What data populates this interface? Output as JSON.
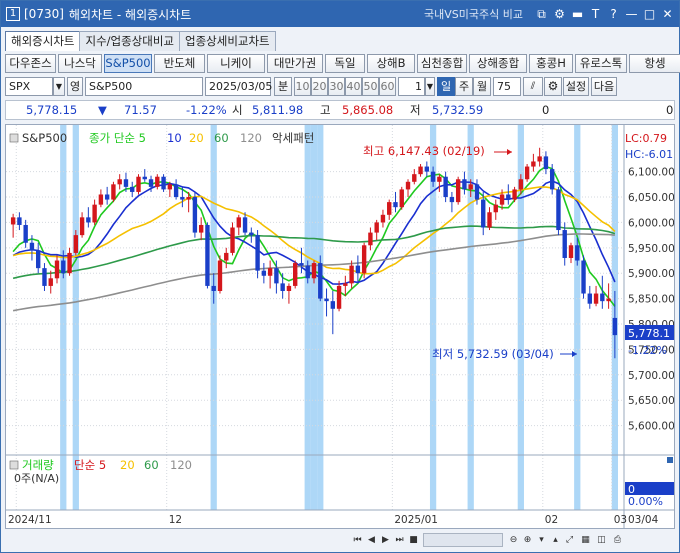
{
  "window": {
    "code": "[0730]",
    "title": "해외차트 - 해외증시차트",
    "compare_link": "국내VS미국주식 비교",
    "controls": [
      "⧉",
      "⚙",
      "▬",
      "T",
      "?",
      "—",
      "□",
      "✕"
    ]
  },
  "tabs": [
    "해외증시차트",
    "지수/업종상대비교",
    "업종상세비교차트"
  ],
  "index_buttons": [
    "다우존스",
    "나스닥",
    "S&P500",
    "반도체",
    "니케이",
    "대만가권",
    "독일",
    "상해B",
    "심천종합",
    "상해종합",
    "홍콩H",
    "유로스톡",
    "항셍"
  ],
  "toolbar": {
    "symbol": "SPX",
    "type_label": "영",
    "name": "S&P500",
    "date": "2025/03/05",
    "unit_label": "분",
    "periods": [
      "10",
      "20",
      "30",
      "40",
      "50",
      "60"
    ],
    "count": "1",
    "day": "일",
    "week": "주",
    "month": "월",
    "bars": "75",
    "settings": "설정",
    "next": "다음"
  },
  "price": {
    "last": "5,778.15",
    "arrow": "▼",
    "change": "71.57",
    "pct": "-1.22%",
    "open_label": "시",
    "open": "5,811.98",
    "high_label": "고",
    "high": "5,865.08",
    "low_label": "저",
    "low": "5,732.59",
    "vol1": "0",
    "vol2": "0"
  },
  "legend": {
    "name": "S&P500",
    "ma_label": "종가 단순 5",
    "ma10": "10",
    "ma20": "20",
    "ma60": "60",
    "ma120": "120",
    "pattern": "악세패턴",
    "lc": "LC:0.79",
    "hc": "HC:-6.01"
  },
  "annotations": {
    "high": "최고 6,147.43 (02/19)",
    "low": "최저 5,732.59 (03/04)",
    "last_tag": "5,778.1",
    "pct_tag": "-1.22%"
  },
  "volume": {
    "label": "거래량",
    "ma_label": "단순 5",
    "ma20": "20",
    "ma60": "60",
    "ma120": "120",
    "unit": "0주(N/A)",
    "tag": "0",
    "pct": "0.00%"
  },
  "axis": {
    "x_labels": [
      "2024/11",
      "12",
      "2025/01",
      "02",
      "03"
    ],
    "x_right": "03/04",
    "y_ticks": [
      6100,
      6050,
      6000,
      5950,
      5900,
      5850,
      5800,
      5750,
      5700,
      5650,
      5600
    ]
  },
  "chart_data": {
    "type": "candlestick",
    "ohlc": [
      [
        5996,
        6017,
        5970,
        6010
      ],
      [
        6010,
        6020,
        5985,
        5995
      ],
      [
        5995,
        6005,
        5950,
        5960
      ],
      [
        5960,
        5975,
        5925,
        5945
      ],
      [
        5945,
        5960,
        5900,
        5910
      ],
      [
        5910,
        5920,
        5865,
        5875
      ],
      [
        5875,
        5905,
        5860,
        5890
      ],
      [
        5890,
        5935,
        5880,
        5925
      ],
      [
        5925,
        5945,
        5890,
        5900
      ],
      [
        5900,
        5950,
        5895,
        5940
      ],
      [
        5940,
        5985,
        5935,
        5975
      ],
      [
        5975,
        6020,
        5970,
        6010
      ],
      [
        6010,
        6030,
        5990,
        6000
      ],
      [
        6000,
        6045,
        5995,
        6035
      ],
      [
        6035,
        6065,
        6030,
        6055
      ],
      [
        6055,
        6070,
        6035,
        6045
      ],
      [
        6045,
        6080,
        6040,
        6075
      ],
      [
        6075,
        6095,
        6065,
        6085
      ],
      [
        6085,
        6098,
        6060,
        6070
      ],
      [
        6070,
        6080,
        6050,
        6060
      ],
      [
        6060,
        6095,
        6055,
        6090
      ],
      [
        6090,
        6105,
        6080,
        6085
      ],
      [
        6085,
        6092,
        6060,
        6070
      ],
      [
        6070,
        6095,
        6065,
        6090
      ],
      [
        6090,
        6095,
        6060,
        6065
      ],
      [
        6065,
        6080,
        6050,
        6075
      ],
      [
        6075,
        6085,
        6045,
        6050
      ],
      [
        6050,
        6070,
        6030,
        6045
      ],
      [
        6045,
        6060,
        6020,
        6050
      ],
      [
        6050,
        6060,
        5970,
        5980
      ],
      [
        5980,
        6010,
        5965,
        5995
      ],
      [
        5995,
        6000,
        5870,
        5875
      ],
      [
        5875,
        5900,
        5840,
        5865
      ],
      [
        5865,
        5935,
        5860,
        5925
      ],
      [
        5925,
        5950,
        5910,
        5940
      ],
      [
        5940,
        6000,
        5935,
        5990
      ],
      [
        5990,
        6015,
        5975,
        6010
      ],
      [
        6010,
        6020,
        5975,
        5980
      ],
      [
        5980,
        5990,
        5960,
        5975
      ],
      [
        5975,
        5985,
        5890,
        5905
      ],
      [
        5905,
        5920,
        5880,
        5895
      ],
      [
        5895,
        5925,
        5870,
        5910
      ],
      [
        5910,
        5925,
        5860,
        5880
      ],
      [
        5880,
        5900,
        5850,
        5865
      ],
      [
        5865,
        5880,
        5840,
        5875
      ],
      [
        5875,
        5925,
        5870,
        5920
      ],
      [
        5920,
        5950,
        5900,
        5915
      ],
      [
        5915,
        5925,
        5880,
        5890
      ],
      [
        5890,
        5925,
        5880,
        5920
      ],
      [
        5920,
        5935,
        5845,
        5850
      ],
      [
        5850,
        5870,
        5815,
        5845
      ],
      [
        5845,
        5865,
        5780,
        5830
      ],
      [
        5830,
        5885,
        5825,
        5875
      ],
      [
        5875,
        5895,
        5855,
        5880
      ],
      [
        5880,
        5925,
        5870,
        5915
      ],
      [
        5915,
        5935,
        5880,
        5900
      ],
      [
        5900,
        5960,
        5890,
        5955
      ],
      [
        5955,
        5990,
        5945,
        5980
      ],
      [
        5980,
        6005,
        5965,
        6000
      ],
      [
        6000,
        6025,
        5990,
        6015
      ],
      [
        6015,
        6045,
        6005,
        6040
      ],
      [
        6040,
        6060,
        6020,
        6030
      ],
      [
        6030,
        6070,
        6025,
        6065
      ],
      [
        6065,
        6085,
        6050,
        6080
      ],
      [
        6080,
        6105,
        6075,
        6095
      ],
      [
        6095,
        6115,
        6090,
        6110
      ],
      [
        6110,
        6120,
        6090,
        6100
      ],
      [
        6100,
        6110,
        6070,
        6080
      ],
      [
        6080,
        6095,
        6060,
        6090
      ],
      [
        6090,
        6100,
        6040,
        6050
      ],
      [
        6050,
        6060,
        6020,
        6040
      ],
      [
        6040,
        6090,
        6035,
        6085
      ],
      [
        6085,
        6100,
        6055,
        6065
      ],
      [
        6065,
        6085,
        6050,
        6075
      ],
      [
        6075,
        6085,
        6035,
        6045
      ],
      [
        6045,
        6060,
        5975,
        5990
      ],
      [
        5990,
        6030,
        5985,
        6020
      ],
      [
        6020,
        6045,
        6005,
        6035
      ],
      [
        6035,
        6065,
        6025,
        6055
      ],
      [
        6055,
        6075,
        6035,
        6045
      ],
      [
        6045,
        6070,
        6040,
        6065
      ],
      [
        6065,
        6095,
        6055,
        6085
      ],
      [
        6085,
        6115,
        6080,
        6110
      ],
      [
        6110,
        6135,
        6100,
        6120
      ],
      [
        6120,
        6147,
        6110,
        6130
      ],
      [
        6130,
        6140,
        6095,
        6105
      ],
      [
        6105,
        6115,
        6055,
        6065
      ],
      [
        6065,
        6070,
        5975,
        5985
      ],
      [
        5985,
        6000,
        5915,
        5930
      ],
      [
        5930,
        5960,
        5920,
        5955
      ],
      [
        5955,
        5970,
        5915,
        5925
      ],
      [
        5925,
        5935,
        5850,
        5860
      ],
      [
        5860,
        5875,
        5830,
        5840
      ],
      [
        5840,
        5875,
        5835,
        5860
      ],
      [
        5860,
        5895,
        5830,
        5845
      ],
      [
        5845,
        5880,
        5830,
        5850
      ],
      [
        5811.98,
        5865.08,
        5732.59,
        5778.15
      ]
    ],
    "ma": [
      {
        "name": "5",
        "color": "#1fc91f"
      },
      {
        "name": "10",
        "color": "#1a2fd0"
      },
      {
        "name": "20",
        "color": "#f5c000"
      },
      {
        "name": "60",
        "color": "#2e9a4a"
      },
      {
        "name": "120",
        "color": "#8e8e8e"
      }
    ],
    "ylim": [
      5550,
      6180
    ]
  }
}
